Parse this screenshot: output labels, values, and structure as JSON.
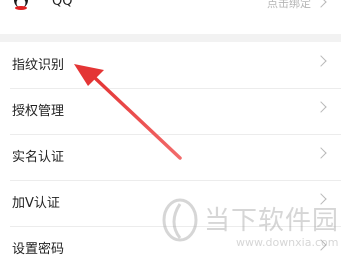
{
  "qq_row": {
    "name": "QQ",
    "status": "点击绑定"
  },
  "menu": {
    "items": [
      {
        "label": "指纹识别"
      },
      {
        "label": "授权管理"
      },
      {
        "label": "实名认证"
      },
      {
        "label": "加V认证"
      },
      {
        "label": "设置密码"
      }
    ]
  },
  "watermark": {
    "brand_name": "当下软件园",
    "url": "www.downxia.com"
  },
  "colors": {
    "arrow": "#ee3b3b",
    "chevron": "#b8b8b8",
    "divider": "#f2f2f2",
    "text": "#222222",
    "muted": "#b5b5b5"
  },
  "icons": {
    "qq_avatar": "qq-penguin-icon",
    "row_arrow": "chevron-right-icon",
    "annotation": "red-arrow-pointer"
  }
}
